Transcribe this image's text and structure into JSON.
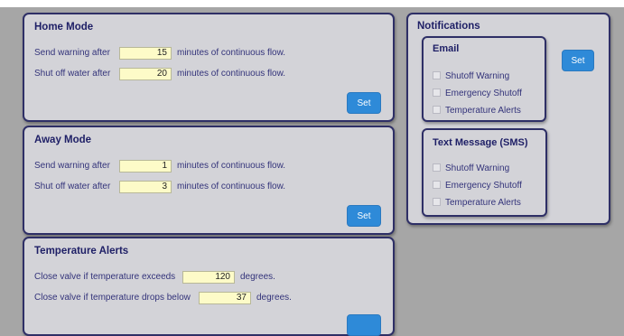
{
  "home_mode": {
    "title": "Home Mode",
    "warning_label": "Send warning after",
    "warning_value": "15",
    "warning_suffix": "minutes of continuous flow.",
    "shutoff_label": "Shut off water after",
    "shutoff_value": "20",
    "shutoff_suffix": "minutes of continuous flow.",
    "set_label": "Set"
  },
  "away_mode": {
    "title": "Away Mode",
    "warning_label": "Send warning after",
    "warning_value": "1",
    "warning_suffix": "minutes of continuous flow.",
    "shutoff_label": "Shut off water after",
    "shutoff_value": "3",
    "shutoff_suffix": "minutes of continuous flow.",
    "set_label": "Set"
  },
  "temperature_alerts": {
    "title": "Temperature Alerts",
    "exceeds_label": "Close valve if temperature exceeds",
    "exceeds_value": "120",
    "exceeds_suffix": "degrees.",
    "below_label": "Close valve if temperature drops below",
    "below_value": "37",
    "below_suffix": "degrees."
  },
  "notifications": {
    "title": "Notifications",
    "set_label": "Set",
    "email": {
      "title": "Email",
      "options": [
        {
          "label": "Shutoff Warning",
          "checked": false
        },
        {
          "label": "Emergency Shutoff",
          "checked": false
        },
        {
          "label": "Temperature Alerts",
          "checked": false
        }
      ]
    },
    "sms": {
      "title": "Text Message (SMS)",
      "options": [
        {
          "label": "Shutoff Warning",
          "checked": false
        },
        {
          "label": "Emergency Shutoff",
          "checked": false
        },
        {
          "label": "Temperature Alerts",
          "checked": false
        }
      ]
    }
  },
  "colors": {
    "page_background": "#a6a6a6",
    "panel_background": "#d3d3d8",
    "panel_border": "#2e2f66",
    "button": "#2e8ad8",
    "input_background": "#fdfbc8"
  }
}
